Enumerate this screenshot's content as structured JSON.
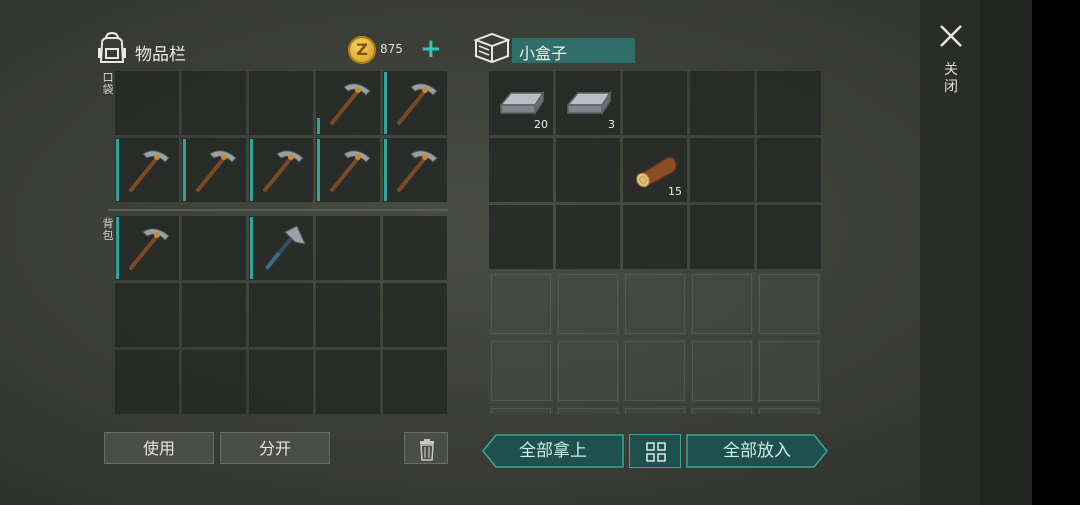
{
  "inventory": {
    "title": "物品栏",
    "coins": "875",
    "coin_glyph": "Z",
    "plus_glyph": "+",
    "pocket_label": "口袋",
    "backpack_label": "背包",
    "pocket_slots": [
      {
        "item": null
      },
      {
        "item": null
      },
      {
        "item": null
      },
      {
        "item": "pickaxe",
        "durability": 0.25
      },
      {
        "item": "pickaxe",
        "durability": 1.0
      },
      {
        "item": "pickaxe",
        "durability": 1.0
      },
      {
        "item": "pickaxe",
        "durability": 1.0
      },
      {
        "item": "pickaxe",
        "durability": 1.0
      },
      {
        "item": "pickaxe",
        "durability": 1.0
      },
      {
        "item": "pickaxe",
        "durability": 1.0
      }
    ],
    "backpack_slots": [
      {
        "item": "pickaxe",
        "durability": 1.0
      },
      {
        "item": null
      },
      {
        "item": "hatchet",
        "durability": 1.0
      },
      {
        "item": null
      },
      {
        "item": null
      },
      {
        "item": null
      },
      {
        "item": null
      },
      {
        "item": null
      },
      {
        "item": null
      },
      {
        "item": null
      },
      {
        "item": null
      },
      {
        "item": null
      },
      {
        "item": null
      },
      {
        "item": null
      },
      {
        "item": null
      }
    ],
    "use_label": "使用",
    "split_label": "分开"
  },
  "container": {
    "title": "小盒子",
    "slots": [
      {
        "item": "iron-ingot",
        "count": "20"
      },
      {
        "item": "iron-ingot",
        "count": "3"
      },
      {
        "item": null
      },
      {
        "item": null
      },
      {
        "item": null
      },
      {
        "item": null
      },
      {
        "item": null
      },
      {
        "item": "log",
        "count": "15"
      },
      {
        "item": null
      },
      {
        "item": null
      },
      {
        "item": null
      },
      {
        "item": null
      },
      {
        "item": null
      },
      {
        "item": null
      },
      {
        "item": null
      },
      {
        "item": null,
        "locked": true
      },
      {
        "item": null,
        "locked": true
      },
      {
        "item": null,
        "locked": true
      },
      {
        "item": null,
        "locked": true
      },
      {
        "item": null,
        "locked": true
      },
      {
        "item": null,
        "locked": true
      },
      {
        "item": null,
        "locked": true
      },
      {
        "item": null,
        "locked": true
      },
      {
        "item": null,
        "locked": true
      },
      {
        "item": null,
        "locked": true
      },
      {
        "item": null,
        "locked": true
      },
      {
        "item": null,
        "locked": true
      },
      {
        "item": null,
        "locked": true
      },
      {
        "item": null,
        "locked": true
      },
      {
        "item": null,
        "locked": true
      }
    ],
    "take_all_label": "全部拿上",
    "put_all_label": "全部放入"
  },
  "close": {
    "label": "关闭"
  },
  "colors": {
    "accent": "#2fa69b",
    "title_bar": "#2f6e69",
    "coin": "#e8b832"
  },
  "icons": [
    "backpack-icon",
    "coin-icon",
    "plus-icon",
    "box-icon",
    "trash-icon",
    "sort-grid-icon",
    "close-icon",
    "pickaxe-icon",
    "hatchet-icon",
    "iron-ingot-icon",
    "log-icon"
  ]
}
